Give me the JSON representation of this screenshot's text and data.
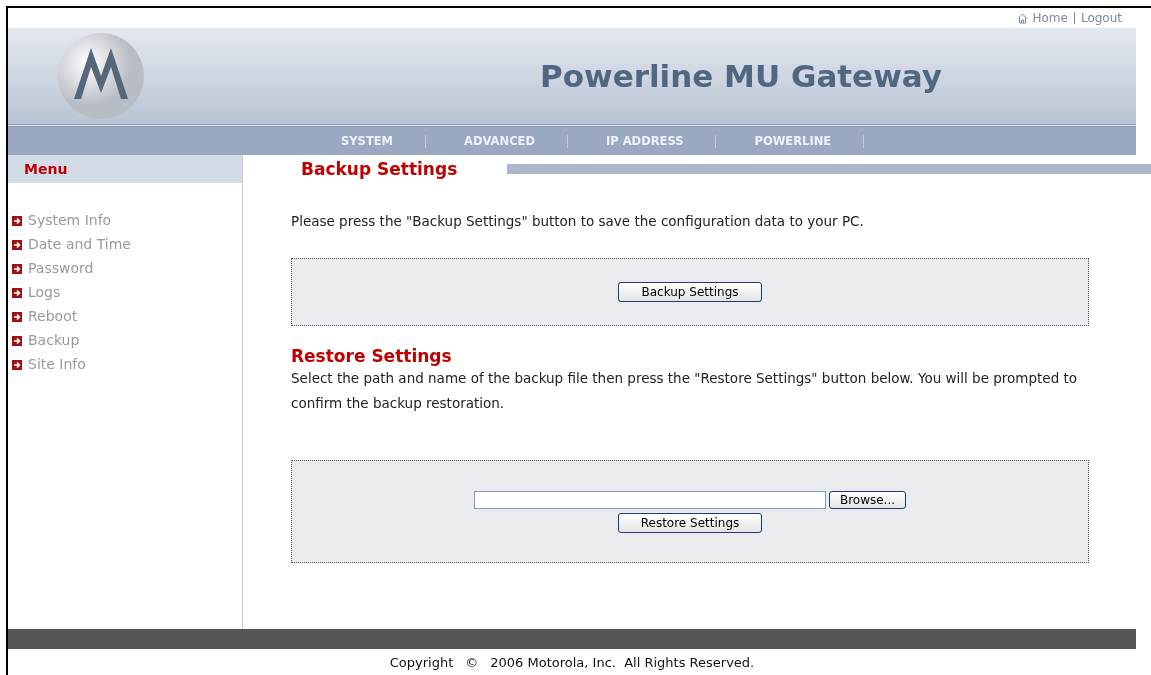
{
  "top_links": [
    "Home",
    "Logout"
  ],
  "header": {
    "title": "Powerline MU Gateway"
  },
  "nav": [
    "SYSTEM",
    "ADVANCED",
    "IP ADDRESS",
    "POWERLINE"
  ],
  "sidebar": {
    "title": "Menu",
    "items": [
      "System Info",
      "Date and Time",
      "Password",
      "Logs",
      "Reboot",
      "Backup",
      "Site Info"
    ]
  },
  "backup": {
    "title": "Backup Settings",
    "text": "Please press the \"Backup Settings\" button to save the configuration data to your PC.",
    "button": "Backup Settings"
  },
  "restore": {
    "title": "Restore Settings",
    "text": "Select the path and name of the backup file then press the \"Restore Settings\" button below. You will be prompted to confirm the backup restoration.",
    "browse": "Browse...",
    "button": "Restore Settings"
  },
  "footer": [
    "Copyright",
    "©",
    "2006 Motorola, Inc.  All Rights Reserved."
  ]
}
